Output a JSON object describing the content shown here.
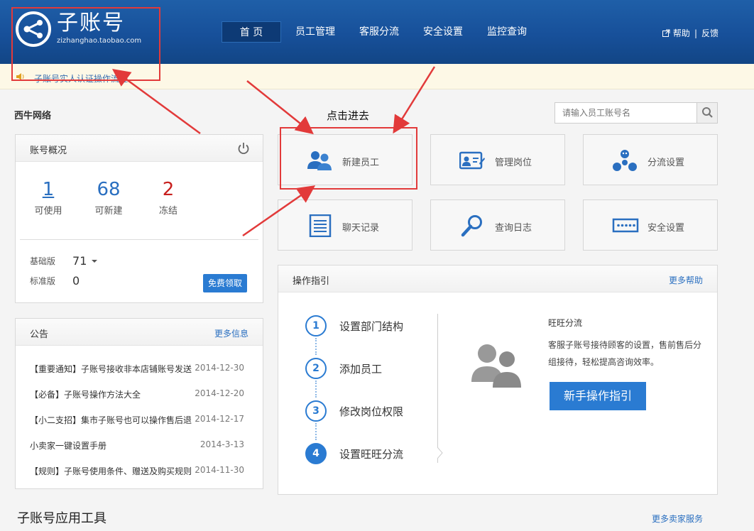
{
  "header": {
    "logo_title": "子账号",
    "logo_sub": "zizhanghao.taobao.com",
    "nav": [
      "首 页",
      "员工管理",
      "客服分流",
      "安全设置",
      "监控查询"
    ],
    "help": "帮助",
    "feedback": "反馈",
    "divider": "|"
  },
  "notice": {
    "text": "子账号实人认证操作流程"
  },
  "company": "西牛网络",
  "overview": {
    "title": "账号概况",
    "stats": [
      {
        "value": "1",
        "label": "可使用",
        "color": "#2a6fc0"
      },
      {
        "value": "68",
        "label": "可新建",
        "color": "#2a6fc0"
      },
      {
        "value": "2",
        "label": "冻结",
        "color": "#c8201e"
      }
    ],
    "plans": [
      {
        "label": "基础版",
        "value": "71"
      },
      {
        "label": "标准版",
        "value": "0"
      }
    ],
    "free_button": "免费领取"
  },
  "announcements": {
    "title": "公告",
    "more": "更多信息",
    "items": [
      {
        "title": "【重要通知】子账号接收非本店铺账号发送",
        "date": "2014-12-30"
      },
      {
        "title": "【必备】子账号操作方法大全",
        "date": "2014-12-20"
      },
      {
        "title": "【小二支招】集市子账号也可以操作售后退",
        "date": "2014-12-17"
      },
      {
        "title": "小卖家一键设置手册",
        "date": "2014-3-13"
      },
      {
        "title": "【规则】子账号使用条件、赠送及购买规则",
        "date": "2014-11-30"
      }
    ]
  },
  "search": {
    "placeholder": "请输入员工账号名"
  },
  "click_hint": "点击进去",
  "tiles": [
    {
      "label": "新建员工",
      "icon": "users-icon"
    },
    {
      "label": "管理岗位",
      "icon": "id-card-icon"
    },
    {
      "label": "分流设置",
      "icon": "flow-icon"
    },
    {
      "label": "聊天记录",
      "icon": "document-icon"
    },
    {
      "label": "查询日志",
      "icon": "magnifier-icon"
    },
    {
      "label": "安全设置",
      "icon": "password-icon"
    }
  ],
  "guide": {
    "title": "操作指引",
    "more": "更多帮助",
    "steps": [
      {
        "num": "1",
        "label": "设置部门结构"
      },
      {
        "num": "2",
        "label": "添加员工"
      },
      {
        "num": "3",
        "label": "修改岗位权限"
      },
      {
        "num": "4",
        "label": "设置旺旺分流"
      }
    ],
    "detail_title": "旺旺分流",
    "detail_desc": "客服子账号接待顾客的设置，售前售后分组接待，轻松提高咨询效率。",
    "button": "新手操作指引"
  },
  "tools": {
    "title": "子账号应用工具",
    "more": "更多卖家服务"
  },
  "colors": {
    "header": "#17509a",
    "accent": "#2a7bd2",
    "highlight": "#e23a3a"
  }
}
